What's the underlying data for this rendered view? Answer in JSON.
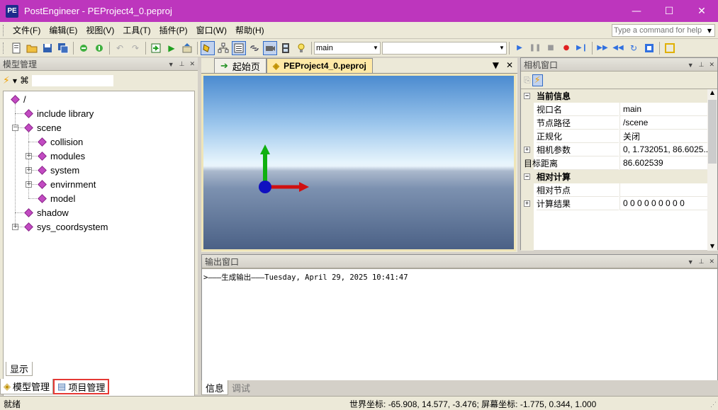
{
  "window": {
    "app_icon": "PE",
    "title": "PostEngineer - PEProject4_0.peproj",
    "controls": [
      "—",
      "☐",
      "✕"
    ]
  },
  "menu": {
    "items": [
      "文件(F)",
      "编辑(E)",
      "视图(V)",
      "工具(T)",
      "插件(P)",
      "窗口(W)",
      "帮助(H)"
    ],
    "command_placeholder": "Type a command for help"
  },
  "toolbar": {
    "camera_combo": "main",
    "second_combo": ""
  },
  "model_panel": {
    "title": "模型管理",
    "tree": [
      {
        "label": "/",
        "depth": 0
      },
      {
        "label": "include library",
        "depth": 1
      },
      {
        "label": "scene",
        "depth": 1,
        "expander": "−"
      },
      {
        "label": "collision",
        "depth": 2
      },
      {
        "label": "modules",
        "depth": 2,
        "expander": "+"
      },
      {
        "label": "system",
        "depth": 2,
        "expander": "+"
      },
      {
        "label": "envirnment",
        "depth": 2,
        "expander": "+"
      },
      {
        "label": "model",
        "depth": 2
      },
      {
        "label": "shadow",
        "depth": 1
      },
      {
        "label": "sys_coordsystem",
        "depth": 1,
        "expander": "+"
      }
    ],
    "show_tab": "显示",
    "tabs": [
      "模型管理",
      "项目管理"
    ]
  },
  "documents": {
    "tabs": [
      "起始页",
      "PEProject4_0.peproj"
    ],
    "active_tab": 1
  },
  "camera_panel": {
    "title": "相机窗口",
    "rows": [
      {
        "type": "cat",
        "key": "当前信息",
        "pm": "−"
      },
      {
        "type": "prop",
        "key": "视口名",
        "value": "main"
      },
      {
        "type": "prop",
        "key": "节点路径",
        "value": "/scene"
      },
      {
        "type": "prop",
        "key": "正规化",
        "value": "关闭"
      },
      {
        "type": "prop",
        "key": "相机参数",
        "value": "0, 1.732051, 86.6025...",
        "pm": "+"
      },
      {
        "type": "prop",
        "key": "目标距离",
        "value": "86.602539",
        "wide": true
      },
      {
        "type": "cat",
        "key": "相对计算",
        "pm": "−"
      },
      {
        "type": "prop",
        "key": "相对节点",
        "value": ""
      },
      {
        "type": "prop",
        "key": "计算结果",
        "value": "0 0 0 0 0 0 0 0 0",
        "pm": "+"
      }
    ]
  },
  "output_panel": {
    "title": "输出窗口",
    "line": ">———生成输出———Tuesday, April 29, 2025 10:41:47",
    "tabs": [
      "信息",
      "调试"
    ]
  },
  "statusbar": {
    "left": "就绪",
    "world_label": "世界坐标:",
    "world_value": "-65.908, 14.577, -3.476;",
    "screen_label": "屏幕坐标:",
    "screen_value": "-1.775, 0.344, 1.000"
  },
  "colors": {
    "titlebar": "#bd36bd",
    "axis_x": "#d01010",
    "axis_y": "#10b010",
    "axis_origin": "#1010c0",
    "highlight": "#e53935"
  }
}
